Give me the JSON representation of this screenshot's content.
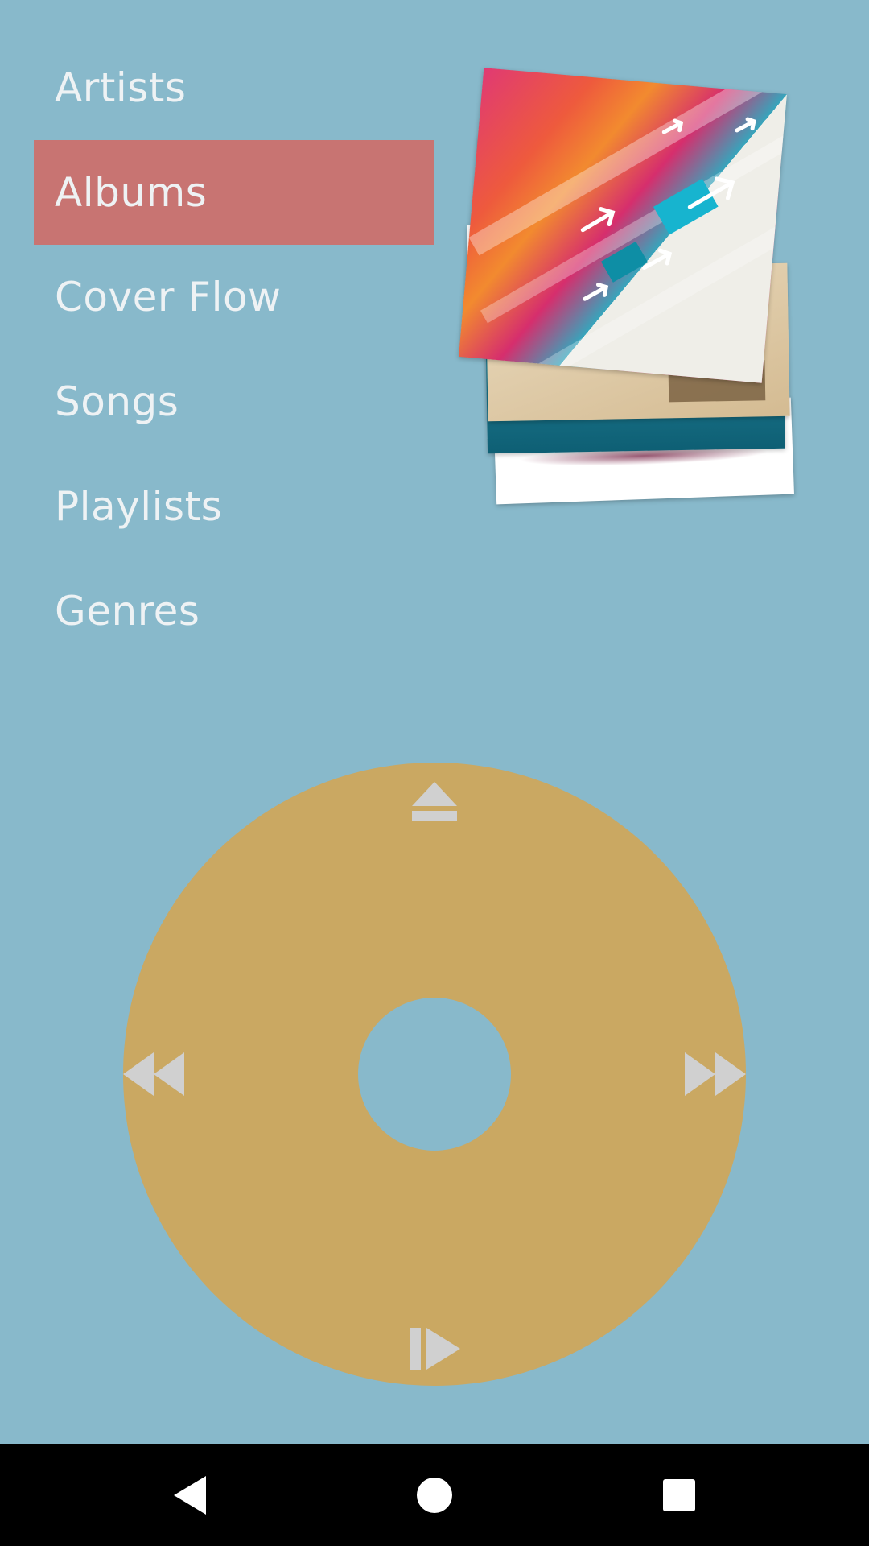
{
  "menu": {
    "items": [
      {
        "label": "Artists",
        "selected": false
      },
      {
        "label": "Albums",
        "selected": true
      },
      {
        "label": "Cover Flow",
        "selected": false
      },
      {
        "label": "Songs",
        "selected": false
      },
      {
        "label": "Playlists",
        "selected": false
      },
      {
        "label": "Genres",
        "selected": false
      }
    ]
  },
  "wheel": {
    "top_icon": "eject-icon",
    "left_icon": "rewind-icon",
    "right_icon": "fast-forward-icon",
    "bottom_icon": "play-pause-icon"
  },
  "navbar": {
    "back_icon": "back-icon",
    "home_icon": "home-icon",
    "recents_icon": "recents-icon"
  },
  "colors": {
    "background": "#88b9cb",
    "selected": "#c87472",
    "wheel": "#caa862",
    "text": "#eef2f4",
    "icon": "#d0d0d0"
  }
}
